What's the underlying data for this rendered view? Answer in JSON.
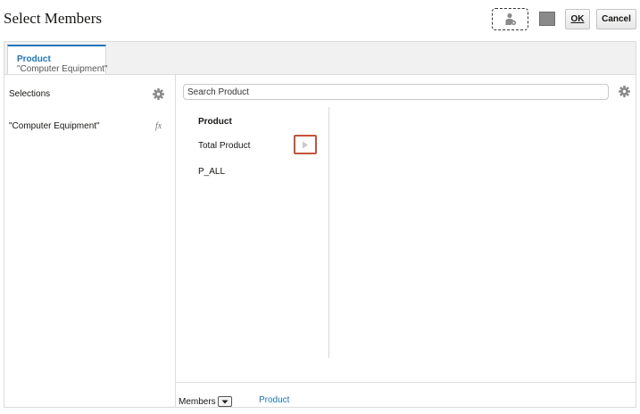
{
  "header": {
    "title": "Select Members",
    "ok_label": "OK",
    "cancel_label": "Cancel"
  },
  "tab": {
    "title": "Product",
    "subtitle": "\"Computer Equipment\""
  },
  "selections": {
    "title": "Selections",
    "items": [
      "\"Computer Equipment\""
    ],
    "fx_label": "fx"
  },
  "search": {
    "placeholder": "Search Product"
  },
  "members_column": {
    "header": "Product",
    "items": [
      "Total Product",
      "P_ALL"
    ]
  },
  "footer": {
    "members_label": "Members",
    "breadcrumb": "Product"
  },
  "colors": {
    "accent": "#1f74b8",
    "highlight": "#c3543a"
  }
}
